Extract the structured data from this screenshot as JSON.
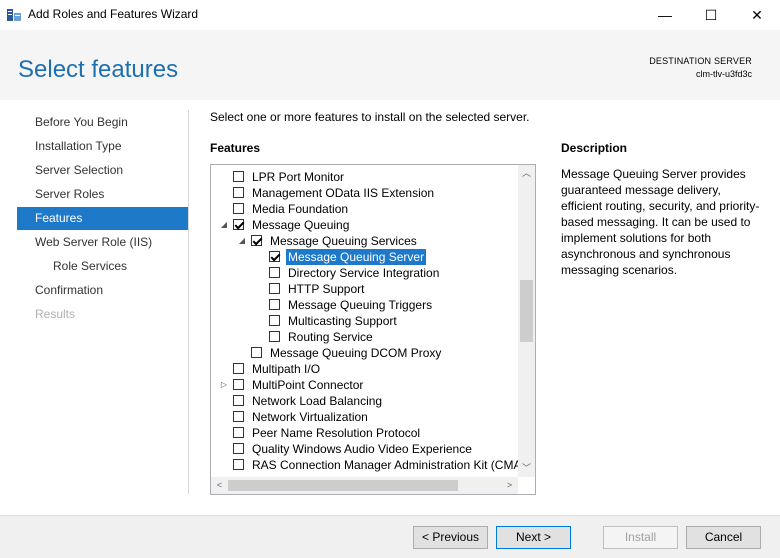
{
  "window": {
    "title": "Add Roles and Features Wizard",
    "minimize_glyph": "—",
    "maximize_glyph": "☐",
    "close_glyph": "✕"
  },
  "header": {
    "page_title": "Select features",
    "destination_label": "DESTINATION SERVER",
    "destination_name": "clm-tlv-u3fd3c"
  },
  "nav": {
    "items": [
      {
        "label": "Before You Begin",
        "state": "normal"
      },
      {
        "label": "Installation Type",
        "state": "normal"
      },
      {
        "label": "Server Selection",
        "state": "normal"
      },
      {
        "label": "Server Roles",
        "state": "normal"
      },
      {
        "label": "Features",
        "state": "active"
      },
      {
        "label": "Web Server Role (IIS)",
        "state": "normal"
      },
      {
        "label": "Role Services",
        "state": "sub"
      },
      {
        "label": "Confirmation",
        "state": "normal"
      },
      {
        "label": "Results",
        "state": "disabled"
      }
    ]
  },
  "main": {
    "instruction": "Select one or more features to install on the selected server.",
    "features_heading": "Features",
    "description_heading": "Description",
    "description_text": "Message Queuing Server provides guaranteed message delivery, efficient routing, security, and priority-based messaging. It can be used to implement solutions for both asynchronous and synchronous messaging scenarios."
  },
  "tree": {
    "items": [
      {
        "label": "LPR Port Monitor",
        "level": 0,
        "checked": false,
        "expander": ""
      },
      {
        "label": "Management OData IIS Extension",
        "level": 0,
        "checked": false,
        "expander": ""
      },
      {
        "label": "Media Foundation",
        "level": 0,
        "checked": false,
        "expander": ""
      },
      {
        "label": "Message Queuing",
        "level": 0,
        "checked": true,
        "expander": "expanded"
      },
      {
        "label": "Message Queuing Services",
        "level": 1,
        "checked": true,
        "expander": "expanded"
      },
      {
        "label": "Message Queuing Server",
        "level": 2,
        "checked": true,
        "expander": "",
        "selected": true
      },
      {
        "label": "Directory Service Integration",
        "level": 2,
        "checked": false,
        "expander": ""
      },
      {
        "label": "HTTP Support",
        "level": 2,
        "checked": false,
        "expander": ""
      },
      {
        "label": "Message Queuing Triggers",
        "level": 2,
        "checked": false,
        "expander": ""
      },
      {
        "label": "Multicasting Support",
        "level": 2,
        "checked": false,
        "expander": ""
      },
      {
        "label": "Routing Service",
        "level": 2,
        "checked": false,
        "expander": ""
      },
      {
        "label": "Message Queuing DCOM Proxy",
        "level": 1,
        "checked": false,
        "expander": ""
      },
      {
        "label": "Multipath I/O",
        "level": 0,
        "checked": false,
        "expander": ""
      },
      {
        "label": "MultiPoint Connector",
        "level": 0,
        "checked": false,
        "expander": "collapsed"
      },
      {
        "label": "Network Load Balancing",
        "level": 0,
        "checked": false,
        "expander": ""
      },
      {
        "label": "Network Virtualization",
        "level": 0,
        "checked": false,
        "expander": ""
      },
      {
        "label": "Peer Name Resolution Protocol",
        "level": 0,
        "checked": false,
        "expander": ""
      },
      {
        "label": "Quality Windows Audio Video Experience",
        "level": 0,
        "checked": false,
        "expander": ""
      },
      {
        "label": "RAS Connection Manager Administration Kit (CMAK)",
        "level": 0,
        "checked": false,
        "expander": ""
      }
    ]
  },
  "scrollbar_glyphs": {
    "up": "︿",
    "down": "﹀",
    "left": "<",
    "right": ">"
  },
  "footer": {
    "previous_label": "< Previous",
    "next_label": "Next >",
    "install_label": "Install",
    "cancel_label": "Cancel"
  },
  "colors": {
    "accent": "#1e79c9",
    "title_blue": "#1e6fae"
  }
}
